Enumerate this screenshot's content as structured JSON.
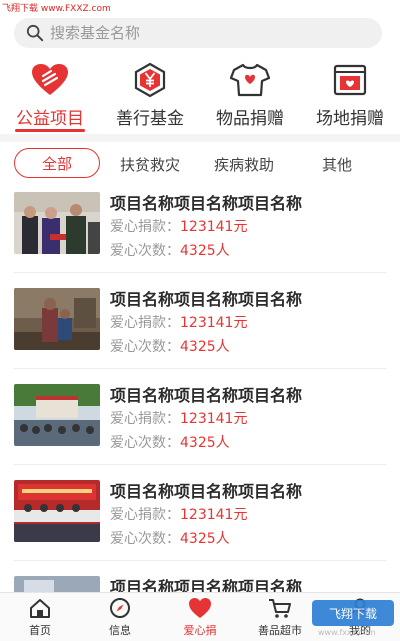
{
  "watermark_top": "飞翔下载 www.FXXZ.com",
  "search": {
    "placeholder": "搜索基金名称"
  },
  "categories": [
    {
      "label": "公益项目",
      "icon": "heart-icon"
    },
    {
      "label": "善行基金",
      "icon": "yen-hexagon-icon"
    },
    {
      "label": "物品捐赠",
      "icon": "tshirt-icon"
    },
    {
      "label": "场地捐赠",
      "icon": "venue-icon"
    }
  ],
  "filter_tabs": [
    "全部",
    "扶贫救灾",
    "疾病救助",
    "其他"
  ],
  "items": [
    {
      "title": "项目名称项目名称项目名称",
      "donation_label": "爱心捐款：",
      "donation_value": "123141元",
      "count_label": "爱心次数：",
      "count_value": "4325人"
    },
    {
      "title": "项目名称项目名称项目名称",
      "donation_label": "爱心捐款：",
      "donation_value": "123141元",
      "count_label": "爱心次数：",
      "count_value": "4325人"
    },
    {
      "title": "项目名称项目名称项目名称",
      "donation_label": "爱心捐款：",
      "donation_value": "123141元",
      "count_label": "爱心次数：",
      "count_value": "4325人"
    },
    {
      "title": "项目名称项目名称项目名称",
      "donation_label": "爱心捐款：",
      "donation_value": "123141元",
      "count_label": "爱心次数：",
      "count_value": "4325人"
    },
    {
      "title": "项目名称项目名称项目名称"
    }
  ],
  "tabbar": [
    {
      "label": "首页",
      "icon": "home-icon"
    },
    {
      "label": "信息",
      "icon": "compass-icon"
    },
    {
      "label": "爱心捐",
      "icon": "heart-icon"
    },
    {
      "label": "善品超市",
      "icon": "cart-icon"
    },
    {
      "label": "我的",
      "icon": "user-icon"
    }
  ],
  "watermark_badge": "飞翔下载",
  "watermark_url": "www.fxxz.com",
  "colors": {
    "accent": "#e63333",
    "search_bg": "#f0f0f0",
    "muted": "#999999"
  }
}
